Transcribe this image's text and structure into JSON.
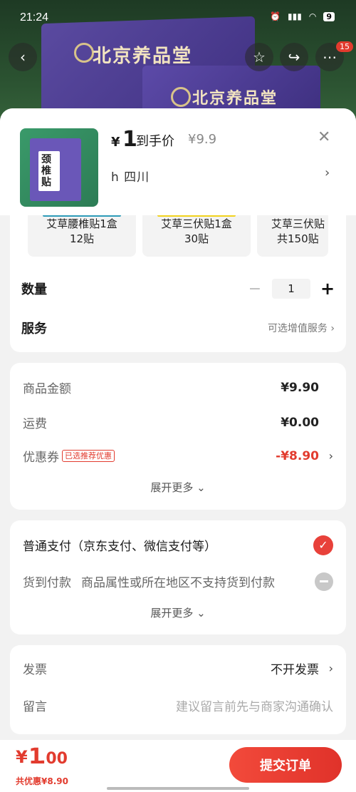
{
  "status_bar": {
    "time": "21:24",
    "battery": "9"
  },
  "product_header": {
    "brand_text": "北京养品堂",
    "nav_badge": "15"
  },
  "sheet": {
    "thumb_text": "颈椎贴",
    "price_symbol": "¥",
    "price_value": "1",
    "price_label": "到手价",
    "original_price": "¥9.9",
    "address": "h  四川"
  },
  "variants": [
    {
      "label_line1": "艾草腰椎贴1盒",
      "label_line2": "12贴"
    },
    {
      "label_line1": "艾草三伏贴1盒",
      "label_line2": "30贴"
    },
    {
      "label_line1": "艾草三伏贴",
      "label_line2": "共150贴"
    }
  ],
  "quantity": {
    "label": "数量",
    "value": "1",
    "minus": "−",
    "plus": "+"
  },
  "service": {
    "label": "服务",
    "value": "可选增值服务"
  },
  "amounts": {
    "goods_label": "商品金额",
    "goods_value": "¥9.90",
    "shipping_label": "运费",
    "shipping_value": "¥0.00",
    "coupon_label": "优惠券",
    "coupon_tag": "已选推荐优惠",
    "coupon_value": "-¥8.90",
    "expand": "展开更多"
  },
  "payment": {
    "normal_label": "普通支付（京东支付、微信支付等）",
    "cod_label": "货到付款",
    "cod_note": "商品属性或所在地区不支持货到付款",
    "expand": "展开更多"
  },
  "invoice": {
    "invoice_label": "发票",
    "invoice_value": "不开发票",
    "message_label": "留言",
    "message_placeholder": "建议留言前先与商家沟通确认"
  },
  "footer": {
    "total_symbol": "¥",
    "total_int": "1",
    "total_dec": ".00",
    "saved": "共优惠¥8.90",
    "submit": "提交订单"
  },
  "colors": {
    "accent": "#e23b2e",
    "header_green": "#2c5432",
    "box_purple": "#4a3a90"
  }
}
